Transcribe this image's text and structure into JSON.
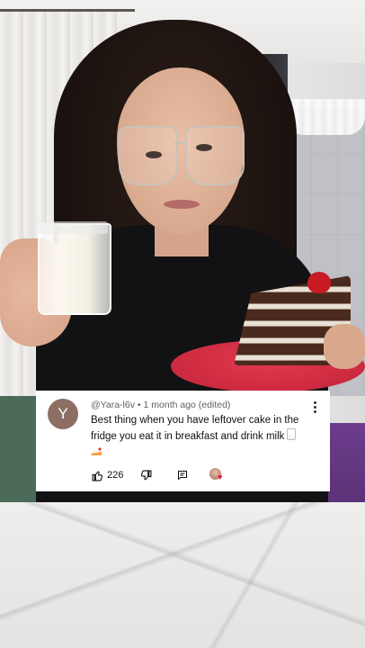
{
  "comment": {
    "avatar_letter": "Y",
    "author": "@Yara-l6v",
    "separator": "•",
    "time": "1 month ago (edited)",
    "text": "Best thing when you have leftover cake in the fridge you eat it in breakfast and drink milk",
    "like_count": "226",
    "icons": [
      "thumbs-up-icon",
      "thumbs-down-icon",
      "reply-icon",
      "creator-heart-icon",
      "more-icon"
    ],
    "colors": {
      "avatar_bg": "#8d6e63",
      "heart": "#e5163f"
    }
  }
}
